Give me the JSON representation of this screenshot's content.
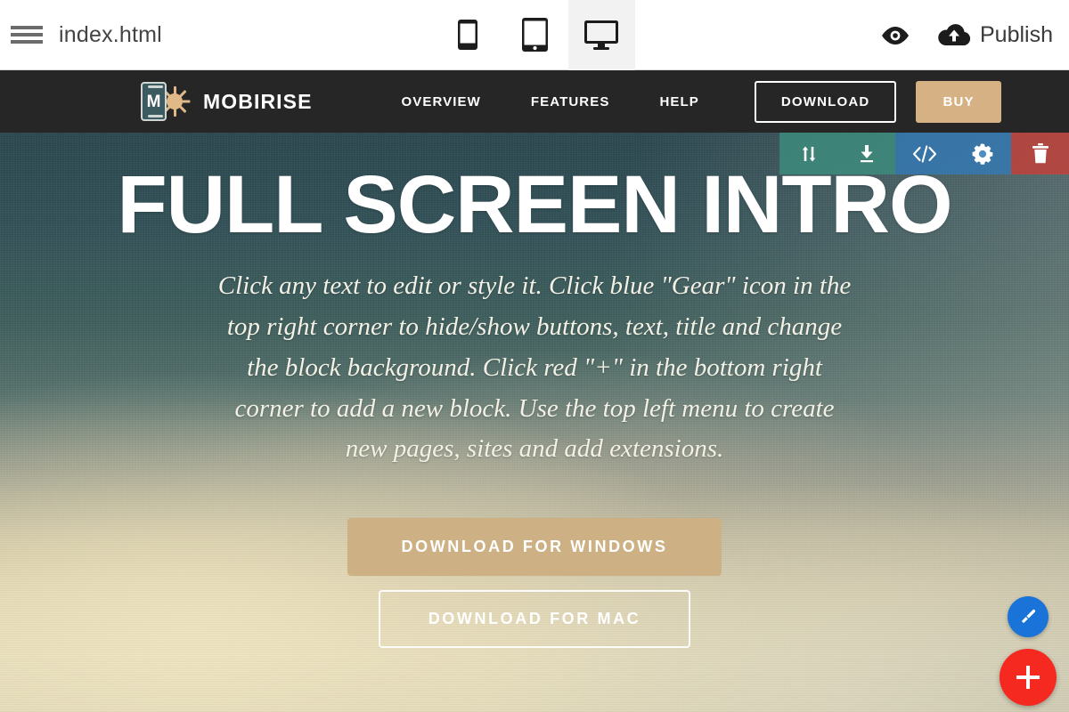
{
  "appbar": {
    "menu_icon": "hamburger-menu-icon",
    "filename": "index.html",
    "devices": [
      {
        "name": "mobile",
        "icon": "mobile-phone-icon",
        "active": false
      },
      {
        "name": "tablet",
        "icon": "tablet-icon",
        "active": false
      },
      {
        "name": "desktop",
        "icon": "desktop-monitor-icon",
        "active": true
      }
    ],
    "preview_icon": "eye-preview-icon",
    "publish_icon": "cloud-upload-icon",
    "publish_label": "Publish"
  },
  "site_nav": {
    "brand": {
      "mark_letter": "M",
      "name": "MOBIRISE"
    },
    "links": [
      {
        "label": "OVERVIEW"
      },
      {
        "label": "FEATURES"
      },
      {
        "label": "HELP"
      }
    ],
    "download_label": "DOWNLOAD",
    "buy_label": "BUY",
    "background": "#262626",
    "buy_color": "#d5b183"
  },
  "block_toolbar": {
    "buttons": [
      {
        "name": "move-block",
        "icon": "move-up-down-arrows-icon",
        "group": "green"
      },
      {
        "name": "save-block",
        "icon": "download-save-icon",
        "group": "green"
      },
      {
        "name": "edit-code",
        "icon": "code-brackets-icon",
        "group": "blue"
      },
      {
        "name": "block-settings",
        "icon": "gear-icon",
        "group": "blue"
      },
      {
        "name": "delete-block",
        "icon": "trash-icon",
        "group": "red"
      }
    ],
    "green": "#3d8c7d",
    "blue": "#337ab7",
    "red": "#c83e37"
  },
  "hero": {
    "title": "FULL SCREEN INTRO",
    "paragraph": "Click any text to edit or style it. Click blue \"Gear\" icon in the top right corner to hide/show buttons, text, title and change the block background. Click red \"+\" in the bottom right corner to add a new block. Use the top left menu to create new pages, sites and add extensions.",
    "btn_windows": "DOWNLOAD FOR WINDOWS",
    "btn_mac": "DOWNLOAD FOR MAC",
    "btn_windows_color": "#cdb184"
  },
  "fabs": [
    {
      "name": "style-button",
      "icon": "paintbrush-icon",
      "color": "#1a73d9"
    },
    {
      "name": "add-block-button",
      "icon": "plus-icon",
      "color": "#f5291f"
    }
  ]
}
